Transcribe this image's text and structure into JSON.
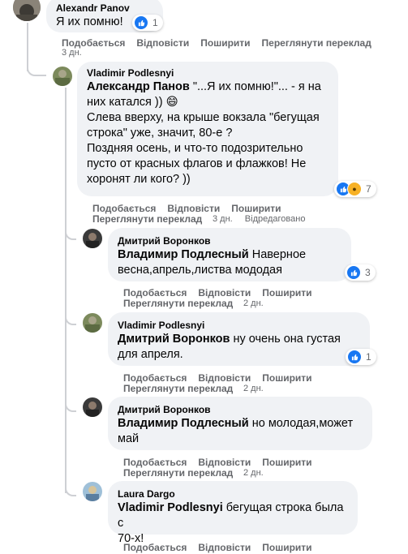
{
  "actions": {
    "like": "Подобається",
    "reply": "Відповісти",
    "share": "Поширити",
    "see_translation": "Переглянути переклад",
    "edited": "Відредаговано"
  },
  "comments": [
    {
      "author": "Alexandr Panov",
      "text": "Я их помню!",
      "reactions": "1",
      "time": "3 дн."
    },
    {
      "author": "Vladimir Podlesnyi",
      "tag": "Александр Панов",
      "text_line1": " \"...Я их помню!\"... - я на",
      "text_line2": "них катался )) 😄",
      "text_line3": "Слева вверху, на крыше вокзала \"бегущая",
      "text_line4": "строка\" уже, значит, 80-е ?",
      "text_line5": "Поздняя осень, и что-то подозрительно",
      "text_line6": "пусто от красных флагов и флажков! Не",
      "text_line7": "хоронят ли кого? ))",
      "reactions": "7",
      "time": "3 дн."
    },
    {
      "author": "Дмитрий Воронков",
      "tag": "Владимир Подлесный",
      "text_line1": " Наверное",
      "text_line2": "весна,апрель,листва мододая",
      "reactions": "3",
      "time": "2 дн."
    },
    {
      "author": "Vladimir Podlesnyi",
      "tag": "Дмитрий Воронков",
      "text_line1": " ну очень она густая",
      "text_line2": "для апреля.",
      "reactions": "1",
      "time": "2 дн."
    },
    {
      "author": "Дмитрий Воронков",
      "tag": "Владимир Подлесный",
      "text_line1": " но молодая,может",
      "text_line2": "май",
      "time": "2 дн."
    },
    {
      "author": "Laura Dargo",
      "tag": "Vladimir Podlesnyi",
      "text_line1": " бегущая строка была с",
      "text_line2": "70-х!"
    }
  ]
}
